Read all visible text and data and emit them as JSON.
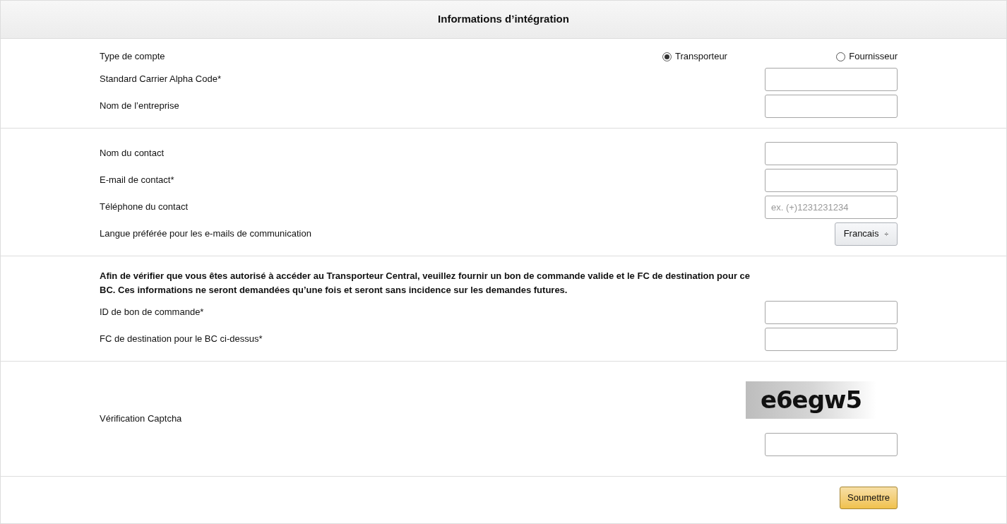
{
  "header": {
    "title": "Informations d’intégration"
  },
  "sections": [
    {
      "rows": [
        {
          "kind": "radio",
          "label": "Type de compte",
          "options": [
            {
              "label": "Transporteur",
              "selected": true
            },
            {
              "label": "Fournisseur",
              "selected": false
            }
          ]
        },
        {
          "kind": "input",
          "label": "Standard Carrier Alpha Code*"
        },
        {
          "kind": "input",
          "label": "Nom de l’entreprise"
        }
      ]
    },
    {
      "rows": [
        {
          "kind": "input",
          "label": "Nom du contact"
        },
        {
          "kind": "input",
          "label": "E-mail de contact*"
        },
        {
          "kind": "input",
          "label": "Téléphone du contact",
          "placeholder": "ex. (+)1231231234"
        },
        {
          "kind": "select",
          "label": "Langue préférée pour les e-mails de communication",
          "value": "Francais",
          "icon": "÷"
        }
      ]
    },
    {
      "note": "Afin de vérifier que vous êtes autorisé à accéder au Transporteur Central, veuillez fournir un bon de commande valide et le FC de destination pour ce BC. Ces informations ne seront demandées qu’une fois et seront sans incidence sur les demandes futures.",
      "rows": [
        {
          "kind": "input",
          "label": "ID de bon de commande*"
        },
        {
          "kind": "input",
          "label": "FC de destination pour le BC ci-dessus*"
        }
      ]
    },
    {
      "rows": [
        {
          "kind": "captcha",
          "label": "Vérification Captcha",
          "captcha": "e6egw5"
        }
      ]
    }
  ],
  "submit": {
    "label": "Soumettre"
  }
}
